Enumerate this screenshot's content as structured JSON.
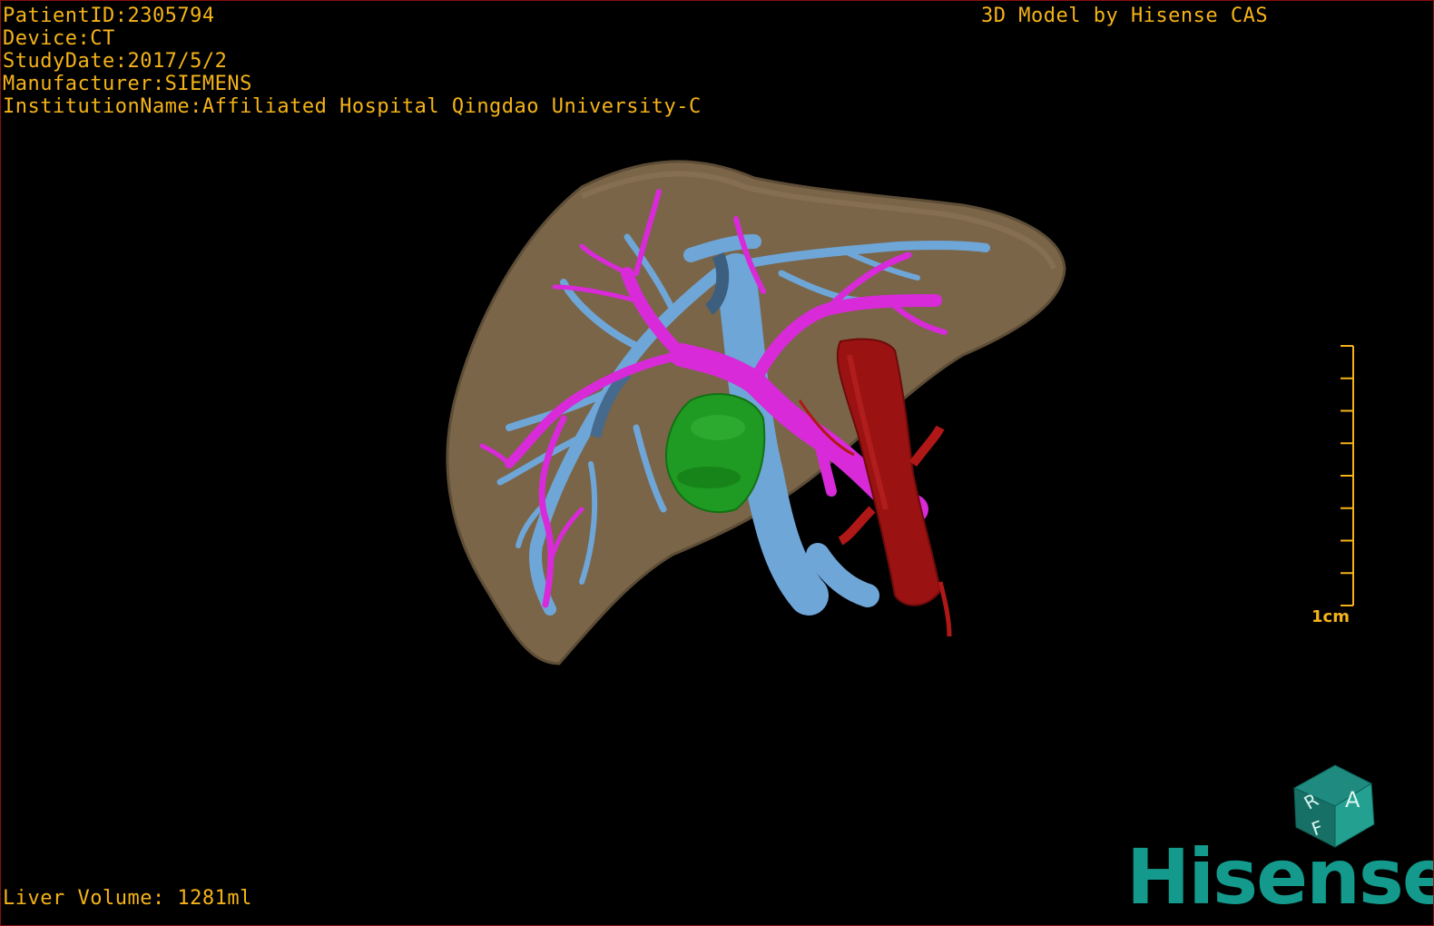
{
  "patient_info": {
    "patient_id": "PatientID:2305794",
    "device": "Device:CT",
    "study_date": "StudyDate:2017/5/2",
    "manufacturer": "Manufacturer:SIEMENS",
    "institution": "InstitutionName:Affiliated Hospital Qingdao University-C"
  },
  "overlay_title": "3D Model by Hisense CAS",
  "liver_volume": "Liver Volume: 1281ml",
  "scale": {
    "label": "1cm",
    "tick_count": 9
  },
  "orientation_cube": {
    "labels": [
      "A",
      "R",
      "F"
    ],
    "icon": "orientation-cube-icon"
  },
  "brand": "Hisense",
  "colors": {
    "overlay_text": "#f5b318",
    "liver": "#7a6548",
    "hepatic_vein": "#6fa6d8",
    "portal_vein": "#d82ad8",
    "aorta": "#9a1212",
    "tumor": "#1f9a22",
    "brand": "#139a8c"
  }
}
